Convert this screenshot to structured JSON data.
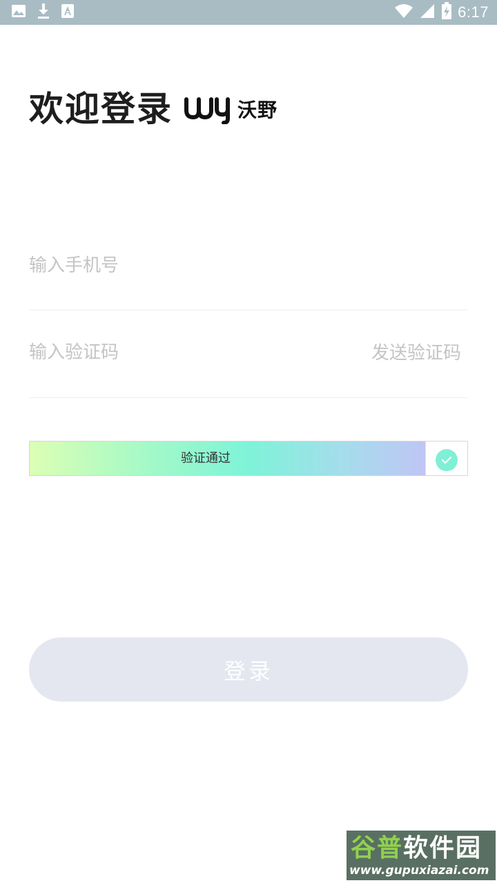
{
  "status_bar": {
    "time": "6:17",
    "left_icons": [
      "image-icon",
      "download-icon",
      "font-icon"
    ],
    "right_icons": [
      "wifi-icon",
      "signal-icon",
      "battery-charging-icon"
    ]
  },
  "header": {
    "title": "欢迎登录",
    "brand_name": "沃野",
    "brand_mark": "wy"
  },
  "form": {
    "phone_placeholder": "输入手机号",
    "code_placeholder": "输入验证码",
    "send_code_label": "发送验证码"
  },
  "slider": {
    "label": "验证通过",
    "progress": 1.0,
    "status_icon": "check-icon"
  },
  "login_button_label": "登录",
  "watermark": {
    "title_part1": "谷普",
    "title_part2": "软件园",
    "url": "www.gupuxiazai.com"
  },
  "colors": {
    "status_bar": "#a9bcc4",
    "login_button": "#e4e7f0",
    "check": "#7ff0d4",
    "placeholder": "#c4c4c4"
  }
}
